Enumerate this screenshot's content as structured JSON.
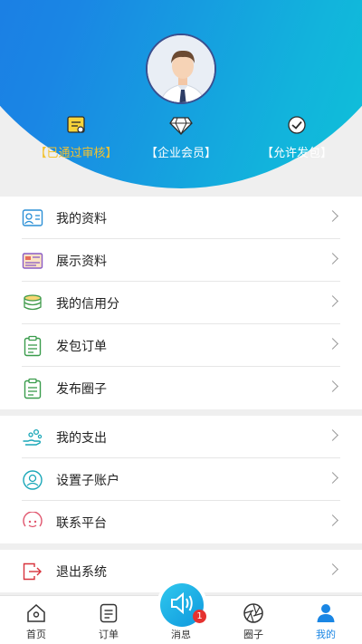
{
  "profile": {
    "badges": [
      {
        "label": "【已通过审核】",
        "icon": "id-card-icon",
        "color": "#f2c230"
      },
      {
        "label": "【企业会员】",
        "icon": "diamond-icon",
        "color": "#ffffff"
      },
      {
        "label": "【允许发包】",
        "icon": "checkmark-icon",
        "color": "#ffffff"
      }
    ]
  },
  "menu_group1": [
    {
      "label": "我的资料",
      "icon": "profile-card-icon"
    },
    {
      "label": "展示资料",
      "icon": "display-card-icon"
    },
    {
      "label": "我的信用分",
      "icon": "coins-icon"
    },
    {
      "label": "发包订单",
      "icon": "clipboard-icon"
    },
    {
      "label": "发布圈子",
      "icon": "clipboard-icon"
    }
  ],
  "menu_group2": [
    {
      "label": "我的支出",
      "icon": "payment-hand-icon"
    },
    {
      "label": "设置子账户",
      "icon": "user-circle-icon"
    },
    {
      "label": "联系平台",
      "icon": "smile-icon"
    }
  ],
  "menu_group3": [
    {
      "label": "退出系统",
      "icon": "logout-icon"
    }
  ],
  "tabbar": {
    "home": "首页",
    "orders": "订单",
    "messages": "消息",
    "circle": "圈子",
    "mine": "我的",
    "message_count": "1",
    "active_color": "#1a86e4"
  }
}
